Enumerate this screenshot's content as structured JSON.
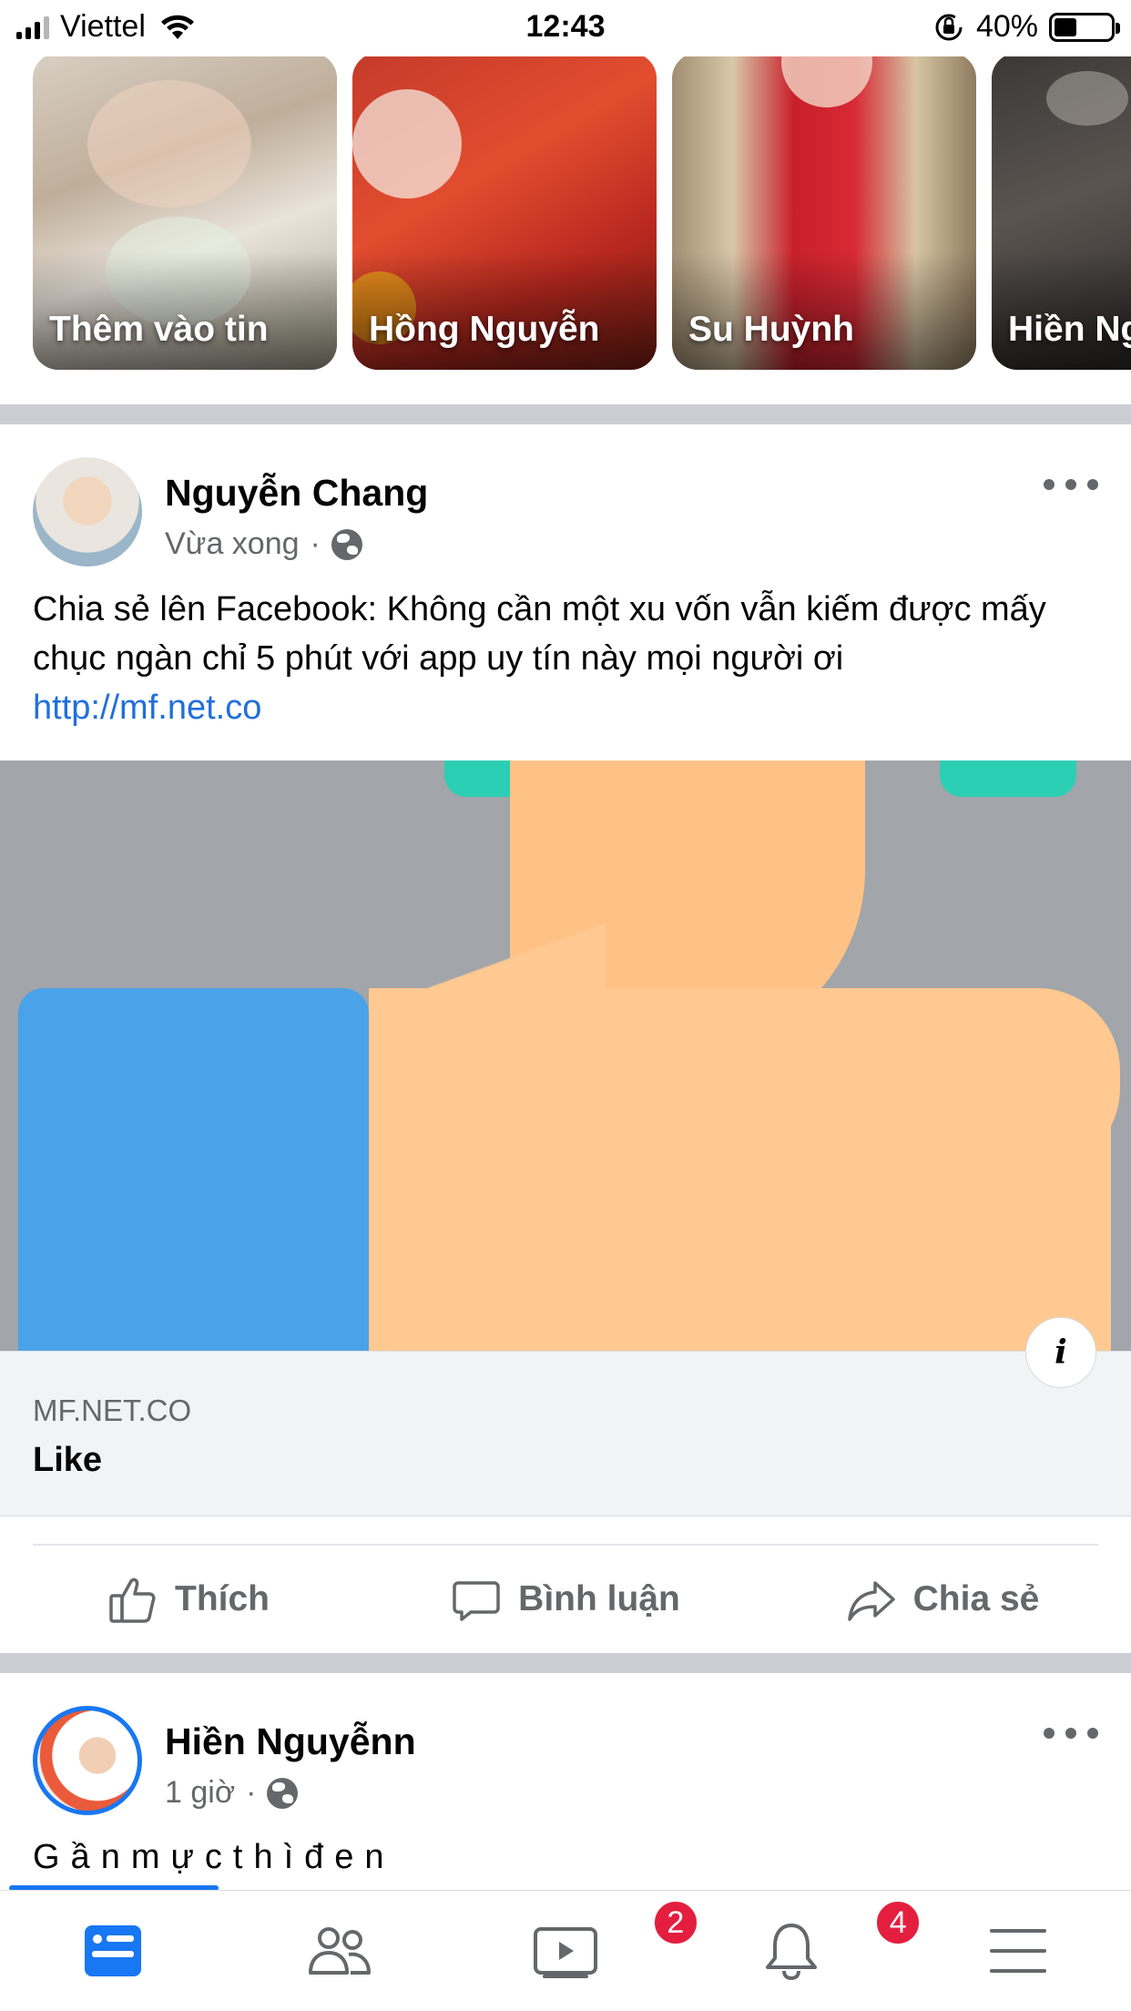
{
  "status_bar": {
    "carrier": "Viettel",
    "time": "12:43",
    "battery_percent": "40%",
    "battery_level": 0.4,
    "icons": [
      "signal-icon",
      "wifi-icon",
      "orientation-lock-icon",
      "battery-icon"
    ]
  },
  "stories": [
    {
      "label": "Thêm vào tin"
    },
    {
      "label": "Hồng Nguyễn"
    },
    {
      "label": "Su Huỳnh"
    },
    {
      "label": "Hiền Ng"
    }
  ],
  "post1": {
    "author": "Nguyễn Chang",
    "time": "Vừa xong",
    "separator": "·",
    "text": "Chia sẻ lên Facebook: Không cần một xu vốn vẫn kiếm được mấy chục ngàn chỉ 5 phút với app uy tín này mọi người ơi",
    "link": "http://mf.net.co",
    "preview": {
      "domain": "MF.NET.CO",
      "title": "Like",
      "info_label": "i"
    },
    "actions": {
      "like": "Thích",
      "comment": "Bình luận",
      "share": "Chia sẻ"
    }
  },
  "post2": {
    "author": "Hiền Nguyễnn",
    "time": "1 giờ",
    "separator": "·",
    "text": "Gầnmựcthìđen"
  },
  "bottom_nav": {
    "items": [
      {
        "icon": "news-feed-icon",
        "active": true,
        "badge": ""
      },
      {
        "icon": "friends-icon",
        "active": false,
        "badge": ""
      },
      {
        "icon": "watch-icon",
        "active": false,
        "badge": "2"
      },
      {
        "icon": "bell-icon",
        "active": false,
        "badge": "4"
      },
      {
        "icon": "menu-icon",
        "active": false,
        "badge": ""
      }
    ]
  },
  "colors": {
    "accent": "#1877f2",
    "link": "#216fdb",
    "badge": "#e41e3f",
    "secondary_text": "#65676b"
  }
}
